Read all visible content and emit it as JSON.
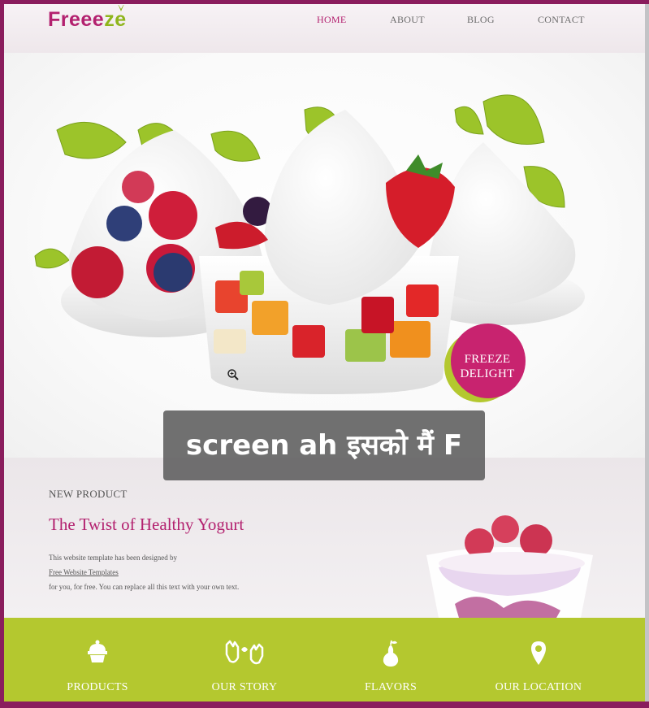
{
  "brand": {
    "logo_part1": "Freee",
    "logo_part2": "ze",
    "primary_color": "#b3216f",
    "accent_color": "#8fb51c",
    "bar_color": "#b4c82f"
  },
  "nav": {
    "items": [
      {
        "label": "HOME",
        "active": true
      },
      {
        "label": "ABOUT",
        "active": false
      },
      {
        "label": "BLOG",
        "active": false
      },
      {
        "label": "CONTACT",
        "active": false
      }
    ]
  },
  "hero": {
    "badge_line1": "FREEZE",
    "badge_line2": "DELIGHT",
    "zoom_icon": "zoom-in-icon"
  },
  "caption": {
    "text": "screen ah इसको मैं F"
  },
  "product": {
    "kicker": "NEW PRODUCT",
    "title": "The Twist of Healthy Yogurt",
    "line1": "This website template has been designed by",
    "link": "Free Website Templates",
    "line3": "for you, for free. You can replace all this text with your own text."
  },
  "features": [
    {
      "label": "PRODUCTS",
      "icon": "cupcake-icon"
    },
    {
      "label": "OUR STORY",
      "icon": "hands-icon"
    },
    {
      "label": "FLAVORS",
      "icon": "pear-icon"
    },
    {
      "label": "OUR LOCATION",
      "icon": "map-pin-icon"
    }
  ]
}
